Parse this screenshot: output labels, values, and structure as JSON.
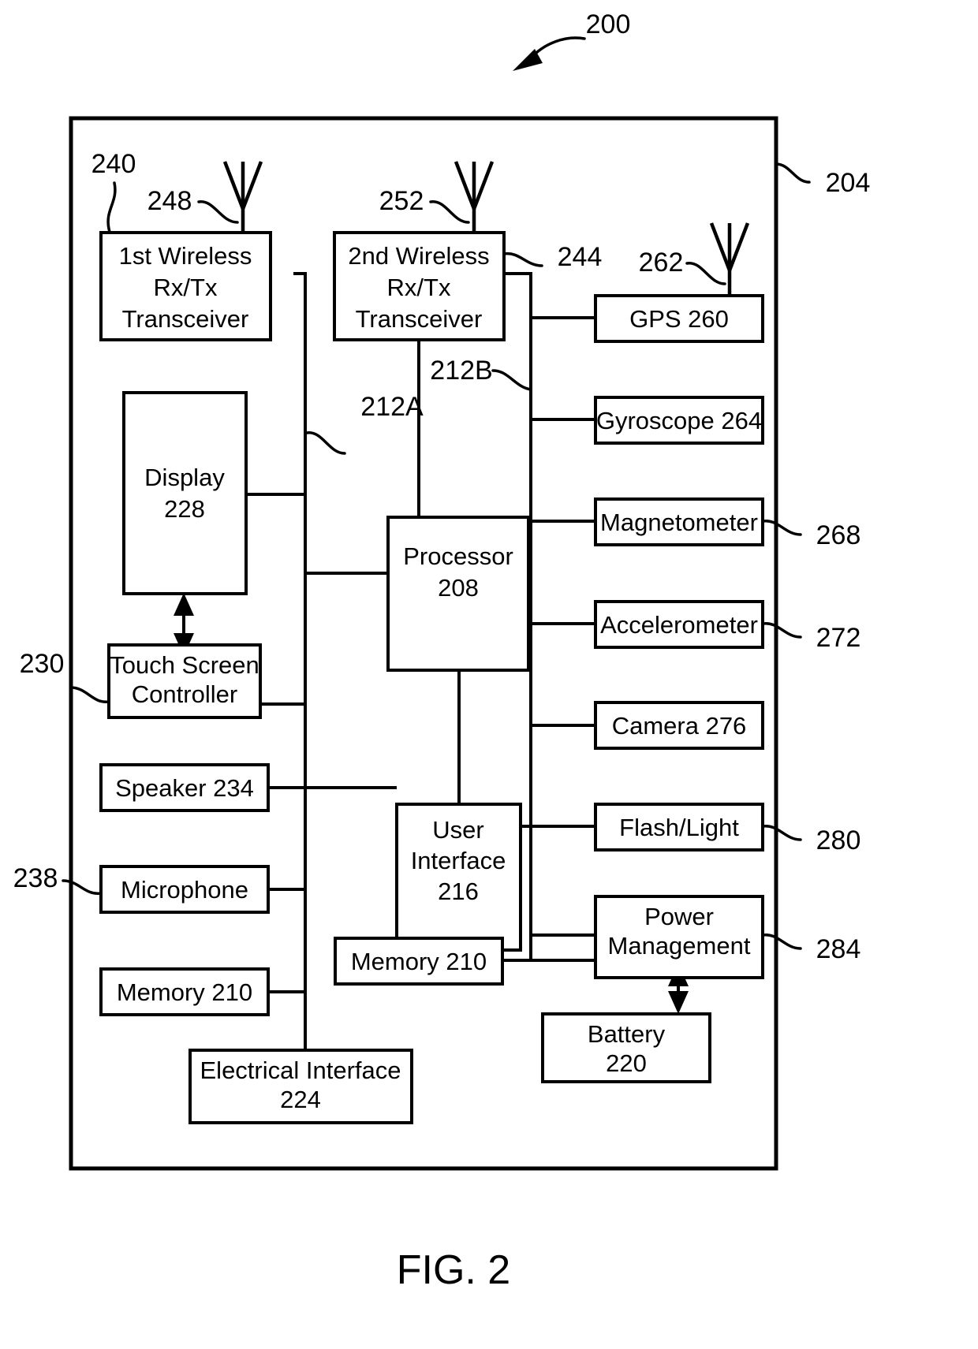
{
  "figure": {
    "caption": "FIG. 2",
    "top_reference": "200",
    "device_boundary_ref": "204"
  },
  "blocks": {
    "wireless1": {
      "lines": [
        "1st Wireless",
        "Rx/Tx",
        "Transceiver"
      ],
      "ref": "240"
    },
    "wireless2": {
      "lines": [
        "2nd Wireless",
        "Rx/Tx",
        "Transceiver"
      ],
      "ref": "244"
    },
    "display": {
      "lines": [
        "Display",
        "228"
      ]
    },
    "touch_screen_controller": {
      "lines": [
        "Touch Screen",
        "Controller"
      ],
      "ref": "230"
    },
    "speaker": {
      "lines": [
        "Speaker 234"
      ]
    },
    "microphone": {
      "lines": [
        "Microphone"
      ],
      "ref": "238"
    },
    "memory_left": {
      "lines": [
        "Memory 210"
      ]
    },
    "electrical_interface": {
      "lines": [
        "Electrical Interface",
        "224"
      ]
    },
    "processor": {
      "lines": [
        "Processor",
        "208"
      ]
    },
    "user_interface": {
      "lines": [
        "User",
        "Interface",
        "216"
      ]
    },
    "memory_center": {
      "lines": [
        "Memory 210"
      ]
    },
    "gps": {
      "lines": [
        "GPS 260"
      ]
    },
    "gyroscope": {
      "lines": [
        "Gyroscope 264"
      ]
    },
    "magnetometer": {
      "lines": [
        "Magnetometer"
      ],
      "ref": "268"
    },
    "accelerometer": {
      "lines": [
        "Accelerometer"
      ],
      "ref": "272"
    },
    "camera": {
      "lines": [
        "Camera 276"
      ]
    },
    "flash_light": {
      "lines": [
        "Flash/Light"
      ],
      "ref": "280"
    },
    "power_management": {
      "lines": [
        "Power",
        "Management"
      ],
      "ref": "284"
    },
    "battery": {
      "lines": [
        "Battery",
        "220"
      ]
    }
  },
  "antennas": {
    "antenna_1": {
      "ref": "248"
    },
    "antenna_2": {
      "ref": "252"
    },
    "antenna_gps": {
      "ref": "262"
    }
  },
  "buses": {
    "bus_a": {
      "ref": "212A"
    },
    "bus_b": {
      "ref": "212B"
    }
  },
  "text": {
    "b_w1_l0": "1st Wireless",
    "b_w1_l1": "Rx/Tx",
    "b_w1_l2": "Transceiver",
    "b_w2_l0": "2nd Wireless",
    "b_w2_l1": "Rx/Tx",
    "b_w2_l2": "Transceiver",
    "b_disp_l0": "Display",
    "b_disp_l1": "228",
    "b_tsc_l0": "Touch Screen",
    "b_tsc_l1": "Controller",
    "b_spk_l0": "Speaker 234",
    "b_mic_l0": "Microphone",
    "b_memL_l0": "Memory 210",
    "b_ei_l0": "Electrical Interface",
    "b_ei_l1": "224",
    "b_proc_l0": "Processor",
    "b_proc_l1": "208",
    "b_ui_l0": "User",
    "b_ui_l1": "Interface",
    "b_ui_l2": "216",
    "b_memC_l0": "Memory 210",
    "b_gps_l0": "GPS 260",
    "b_gyro_l0": "Gyroscope 264",
    "b_mag_l0": "Magnetometer",
    "b_acc_l0": "Accelerometer",
    "b_cam_l0": "Camera 276",
    "b_fl_l0": "Flash/Light",
    "b_pm_l0": "Power",
    "b_pm_l1": "Management",
    "b_bat_l0": "Battery",
    "b_bat_l1": "220",
    "r_200": "200",
    "r_204": "204",
    "r_240": "240",
    "r_244": "244",
    "r_248": "248",
    "r_252": "252",
    "r_262": "262",
    "r_230": "230",
    "r_238": "238",
    "r_212A": "212A",
    "r_212B": "212B",
    "r_268": "268",
    "r_272": "272",
    "r_280": "280",
    "r_284": "284",
    "caption": "FIG. 2"
  }
}
